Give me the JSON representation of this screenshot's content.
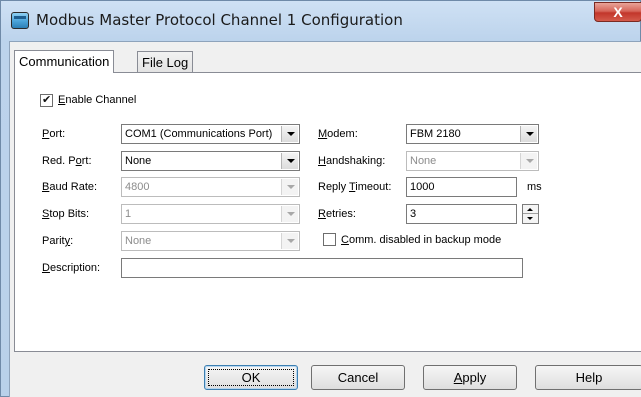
{
  "window": {
    "title": "Modbus Master Protocol Channel 1 Configuration",
    "close_glyph": "X"
  },
  "tabs": [
    {
      "label": "Communication",
      "active": true
    },
    {
      "label": "File Log",
      "active": false
    }
  ],
  "form": {
    "enable_channel": {
      "label_prefix": "",
      "mnemonic": "E",
      "label_rest": "nable Channel",
      "checked": true
    },
    "port": {
      "mnemonic": "P",
      "label_rest": "ort:",
      "value": "COM1 (Communications Port)"
    },
    "red_port": {
      "label_prefix": "Red. P",
      "mnemonic": "o",
      "label_rest": "rt:",
      "value": "None"
    },
    "baud_rate": {
      "mnemonic": "B",
      "label_rest": "aud Rate:",
      "value": "4800"
    },
    "stop_bits": {
      "mnemonic": "S",
      "label_rest": "top Bits:",
      "value": "1"
    },
    "parity": {
      "label_prefix": "Parit",
      "mnemonic": "y",
      "label_rest": ":",
      "value": "None"
    },
    "description": {
      "mnemonic": "D",
      "label_rest": "escription:",
      "value": ""
    },
    "modem": {
      "mnemonic": "M",
      "label_rest": "odem:",
      "value": "FBM 2180"
    },
    "handshaking": {
      "mnemonic": "H",
      "label_rest": "andshaking:",
      "value": "None"
    },
    "reply_timeout": {
      "label_prefix": "Reply ",
      "mnemonic": "T",
      "label_rest": "imeout:",
      "value": "1000",
      "unit": "ms"
    },
    "retries": {
      "mnemonic": "R",
      "label_rest": "etries:",
      "value": "3"
    },
    "comm_disabled": {
      "mnemonic": "C",
      "label_rest": "omm. disabled in backup mode",
      "checked": false
    }
  },
  "buttons": {
    "ok": "OK",
    "cancel": "Cancel",
    "apply_mnemonic": "A",
    "apply_rest": "pply",
    "help": "Help"
  }
}
